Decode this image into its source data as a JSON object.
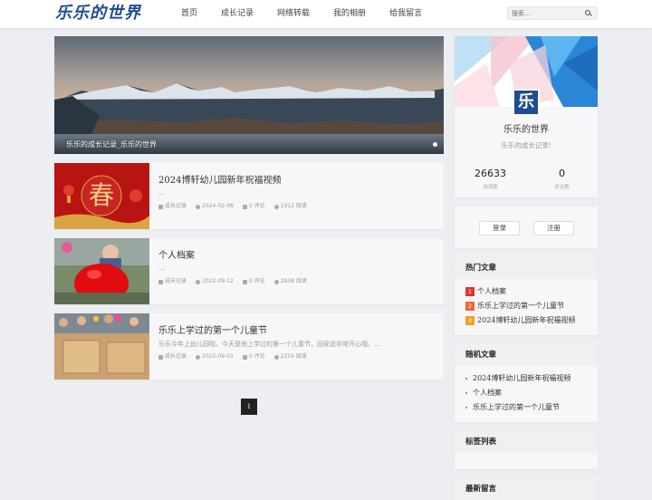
{
  "site": {
    "logo": "乐乐的世界"
  },
  "nav": [
    "首页",
    "成长记录",
    "网络转载",
    "我的相册",
    "给我留言"
  ],
  "search": {
    "placeholder": "搜索..."
  },
  "hero": {
    "caption": "乐乐的成长记录_乐乐的世界"
  },
  "posts": [
    {
      "title": "2024博轩幼儿园新年祝福视频",
      "excerpt": "...",
      "category": "成长记录",
      "date": "2024-02-08",
      "comments": "0 评论",
      "views": "1912 阅读"
    },
    {
      "title": "个人档案",
      "excerpt": "...",
      "category": "成长记录",
      "date": "2022-09-12",
      "comments": "0 评论",
      "views": "2838 阅读"
    },
    {
      "title": "乐乐上学过的第一个儿童节",
      "excerpt": "乐乐今年上幼儿园啦。今天是他上学过的第一个儿童节，回家说非常开心哦。...",
      "category": "成长记录",
      "date": "2022-09-01",
      "comments": "0 评论",
      "views": "2255 阅读"
    }
  ],
  "pagination": {
    "current": "1"
  },
  "profile": {
    "avatar_text": "乐",
    "name": "乐乐的世界",
    "desc": "乐乐的成长记录!",
    "reads": "26633",
    "reads_label": "阅读数",
    "comments": "0",
    "comments_label": "评论数"
  },
  "auth": {
    "login": "登录",
    "register": "注册"
  },
  "hot": {
    "title": "热门文章",
    "items": [
      {
        "num": "1",
        "label": "个人档案",
        "color": "#e0352b"
      },
      {
        "num": "2",
        "label": "乐乐上学过的第一个儿童节",
        "color": "#f0643a"
      },
      {
        "num": "3",
        "label": "2024博轩幼儿园新年祝福视频",
        "color": "#f0a020"
      }
    ]
  },
  "random": {
    "title": "随机文章",
    "items": [
      "2024博轩幼儿园新年祝福视频",
      "个人档案",
      "乐乐上学过的第一个儿童节"
    ]
  },
  "tags": {
    "title": "标签列表"
  },
  "latest": {
    "title": "最新留言"
  }
}
